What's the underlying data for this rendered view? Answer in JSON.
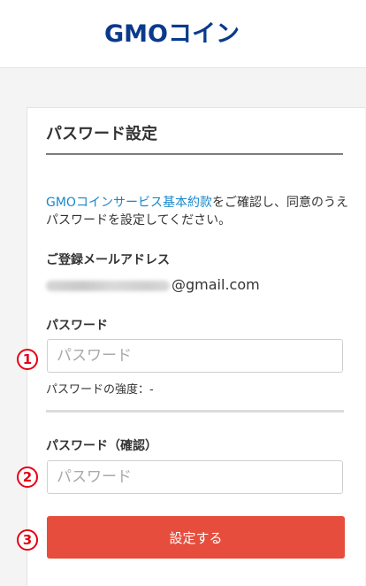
{
  "header": {
    "logo_text": "GMOコイン"
  },
  "form": {
    "title": "パスワード設定",
    "terms_link": "GMOコインサービス基本約款",
    "terms_text": "をご確認し、同意のうえパスワードを設定してください。",
    "email_label": "ご登録メールアドレス",
    "email_domain": "@gmail.com",
    "password_label": "パスワード",
    "password_placeholder": "パスワード",
    "strength_text": "パスワードの強度：-",
    "confirm_label": "パスワード（確認）",
    "confirm_placeholder": "パスワード",
    "submit_label": "設定する"
  },
  "annotations": {
    "step1": "1",
    "step2": "2",
    "step3": "3"
  },
  "colors": {
    "brand": "#0a3a8c",
    "link": "#1a87c9",
    "submit": "#e64d3d",
    "annotation": "#e60012"
  }
}
